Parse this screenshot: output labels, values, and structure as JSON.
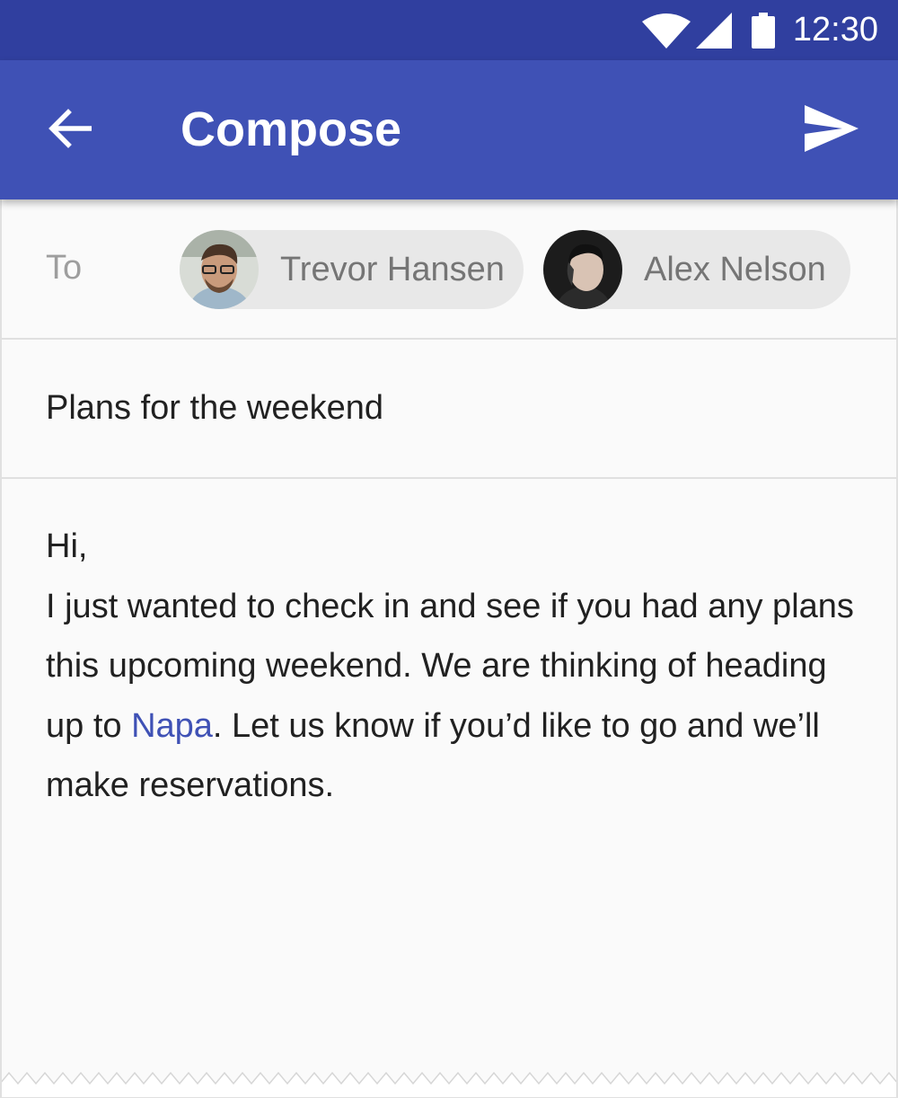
{
  "status_bar": {
    "time": "12:30",
    "icons": [
      "wifi-icon",
      "signal-icon",
      "battery-icon"
    ]
  },
  "app_bar": {
    "title": "Compose",
    "back_icon": "arrow-back-icon",
    "send_icon": "send-icon",
    "color": "#3f51b5",
    "status_color": "#303f9f"
  },
  "recipients": {
    "label": "To",
    "chips": [
      {
        "name": "Trevor Hansen",
        "avatar": "avatar-trevor"
      },
      {
        "name": "Alex Nelson",
        "avatar": "avatar-alex"
      }
    ]
  },
  "subject": {
    "value": "Plans for the weekend"
  },
  "message": {
    "greeting": "Hi,",
    "text_before_link": "I just wanted to check in and see if you had any plans this upcoming weekend. We are thinking of heading up to ",
    "link_text": "Napa",
    "text_after_link": ". Let us know if you’d like to go and we’ll make reservations.",
    "link_color": "#3f51b5"
  }
}
